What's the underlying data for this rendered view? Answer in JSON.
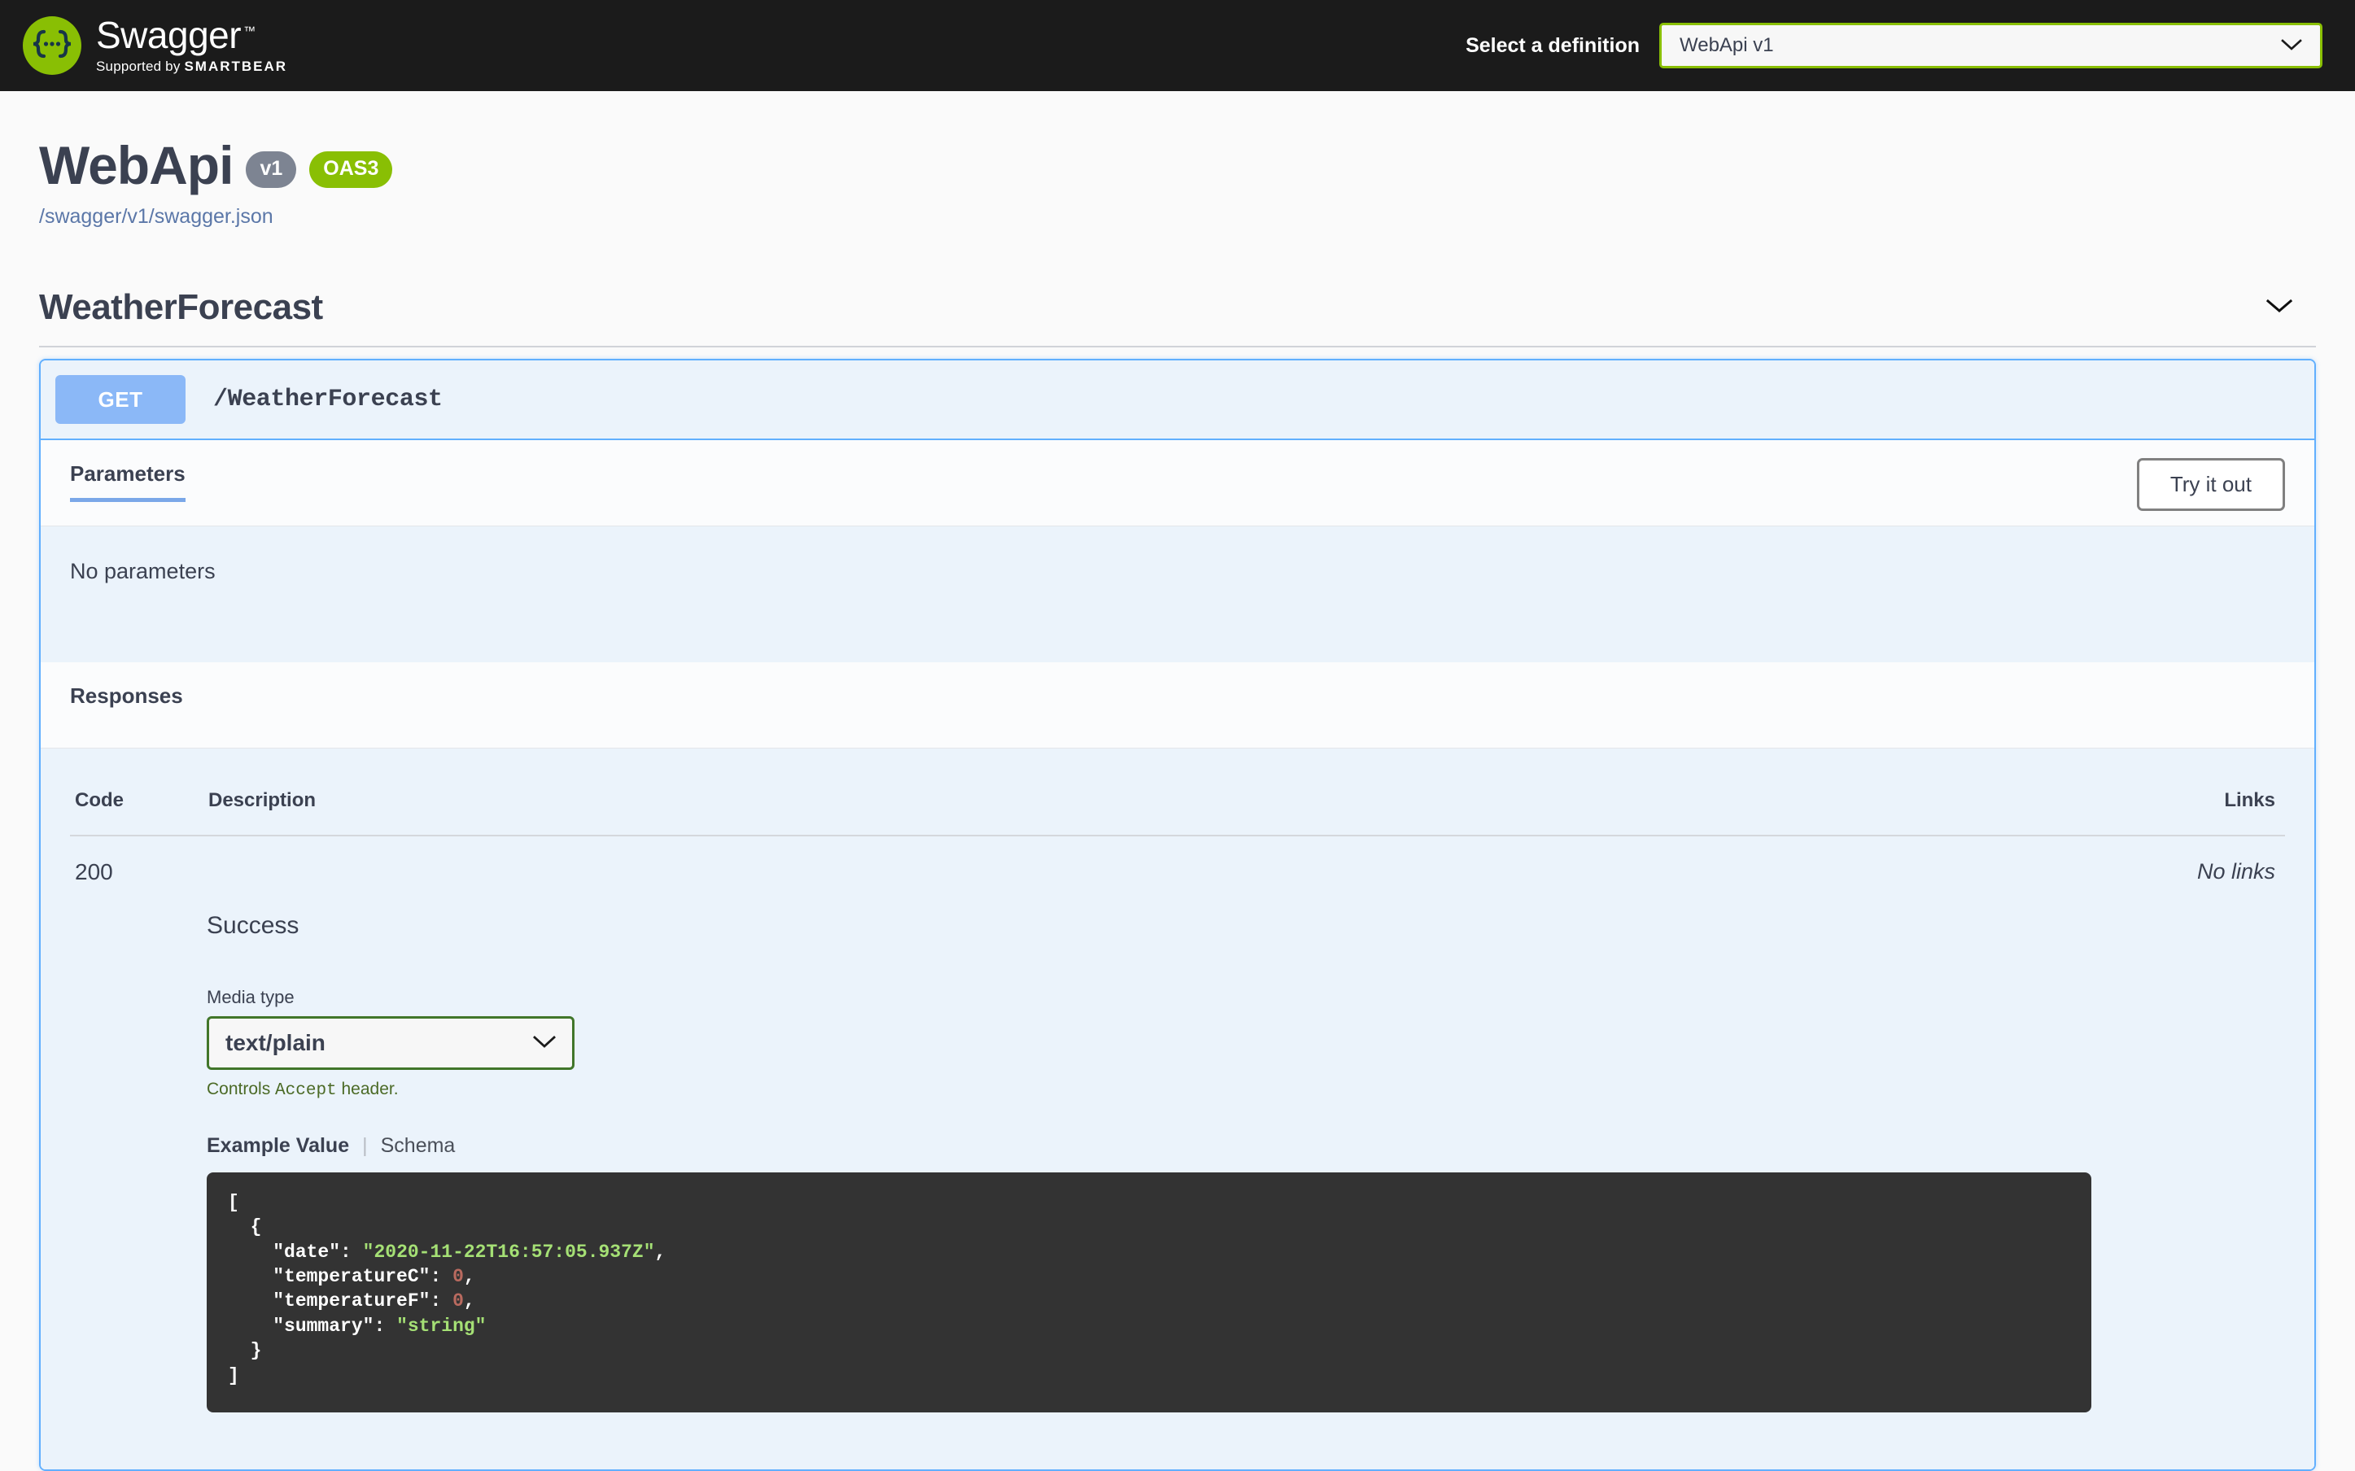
{
  "topbar": {
    "logo_text": "Swagger",
    "logo_tm": "™",
    "logo_sub_prefix": "Supported by",
    "logo_sub_brand": "SMARTBEAR",
    "select_label": "Select a definition",
    "definition_value": "WebApi v1",
    "chevron": "⌄"
  },
  "info": {
    "title": "WebApi",
    "version_badge": "v1",
    "oas_badge": "OAS3",
    "spec_url": "/swagger/v1/swagger.json"
  },
  "tag": {
    "name": "WeatherForecast"
  },
  "operation": {
    "method": "GET",
    "path": "/WeatherForecast",
    "parameters_title": "Parameters",
    "try_it_out_label": "Try it out",
    "no_parameters_text": "No parameters",
    "responses_title": "Responses",
    "table_headers": {
      "code": "Code",
      "description": "Description",
      "links": "Links"
    },
    "response": {
      "code": "200",
      "description": "Success",
      "links": "No links",
      "media_type_label": "Media type",
      "media_type_value": "text/plain",
      "accept_note_before": "Controls ",
      "accept_note_code": "Accept",
      "accept_note_after": " header.",
      "example_tab": "Example Value",
      "schema_tab": "Schema",
      "tab_separator": "|",
      "example_json": {
        "line_open_array": "[",
        "line_open_obj": "  {",
        "field_date_key": "\"date\"",
        "field_date_value": "\"2020-11-22T16:57:05.937Z\"",
        "field_tempc_key": "\"temperatureC\"",
        "field_tempc_value": "0",
        "field_tempf_key": "\"temperatureF\"",
        "field_tempf_value": "0",
        "field_summary_key": "\"summary\"",
        "field_summary_value": "\"string\"",
        "line_close_obj": "  }",
        "line_close_array": "]"
      }
    }
  },
  "colors": {
    "topbar_bg": "#1b1b1b",
    "brand_green": "#89bf04",
    "get_blue": "#61affe",
    "get_badge": "#8bb8f7",
    "body_blue": "#ebf3fb",
    "text": "#3b4151",
    "link": "#5b77a8",
    "code_bg": "#333333"
  }
}
